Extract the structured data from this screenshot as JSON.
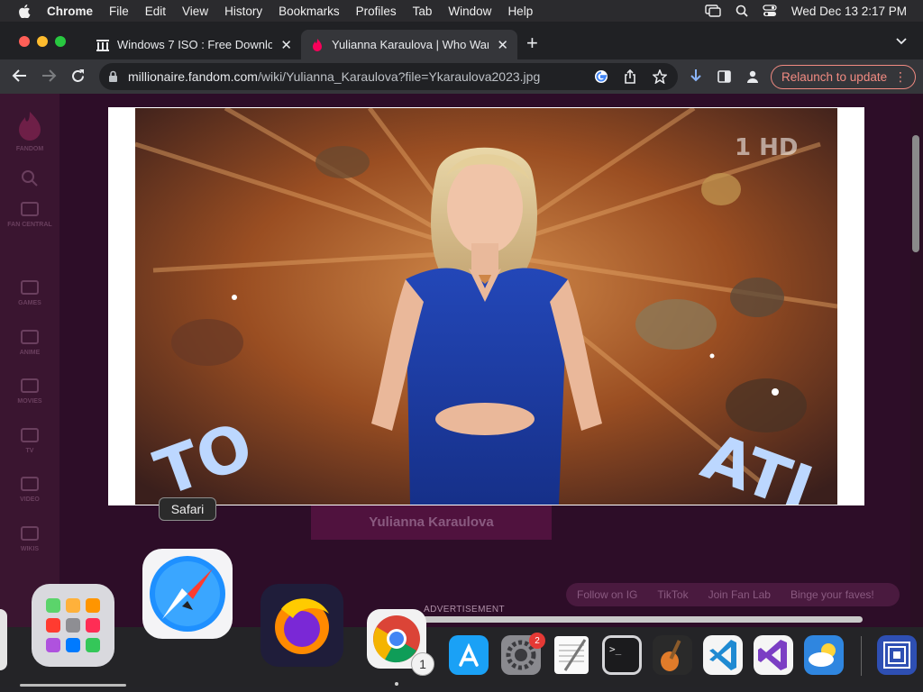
{
  "menubar": {
    "app": "Chrome",
    "items": [
      "File",
      "Edit",
      "View",
      "History",
      "Bookmarks",
      "Profiles",
      "Tab",
      "Window",
      "Help"
    ],
    "clock": "Wed Dec 13  2:17 PM"
  },
  "tabs": [
    {
      "title": "Windows 7 ISO : Free Downloa",
      "favicon": "archive-icon",
      "active": false
    },
    {
      "title": "Yulianna Karaulova | Who Want",
      "favicon": "fandom-icon",
      "active": true
    }
  ],
  "toolbar": {
    "url_domain": "millionaire.fandom.com",
    "url_path": "/wiki/Yulianna_Karaulova?file=Ykaraulova2023.jpg",
    "relaunch_label": "Relaunch to update",
    "accent": "#f28b82"
  },
  "fandom_rail": [
    {
      "label": "FANDOM",
      "icon": "fandom-flame-icon"
    },
    {
      "label": "FAN CENTRAL",
      "icon": "fan-central-icon"
    },
    {
      "label": "GAMES",
      "icon": "games-icon"
    },
    {
      "label": "ANIME",
      "icon": "anime-icon"
    },
    {
      "label": "MOVIES",
      "icon": "movies-icon"
    },
    {
      "label": "TV",
      "icon": "tv-icon"
    },
    {
      "label": "VIDEO",
      "icon": "video-icon"
    },
    {
      "label": "WIKIS",
      "icon": "wikis-icon"
    }
  ],
  "background_page": {
    "infobox_title": "Yulianna Karaulova",
    "advertisement": "ADVERTISEMENT",
    "bottom_bar": [
      "Follow on IG",
      "TikTok",
      "Join Fan Lab",
      "Binge your faves!"
    ]
  },
  "lightbox": {
    "image_file": "Ykaraulova2023.jpg",
    "watermark": "1 HD"
  },
  "dock": {
    "tooltip": "Safari",
    "apps": [
      {
        "name": "launchpad-icon"
      },
      {
        "name": "safari-icon"
      },
      {
        "name": "firefox-icon"
      },
      {
        "name": "chrome-icon",
        "badge": "1"
      },
      {
        "name": "app-store-icon"
      },
      {
        "name": "system-settings-icon",
        "badge": "2"
      },
      {
        "name": "textedit-icon"
      },
      {
        "name": "terminal-icon"
      },
      {
        "name": "garageband-icon"
      },
      {
        "name": "vscode-icon"
      },
      {
        "name": "visual-studio-icon"
      },
      {
        "name": "weather-icon"
      },
      {
        "name": "screen-icon"
      }
    ]
  }
}
